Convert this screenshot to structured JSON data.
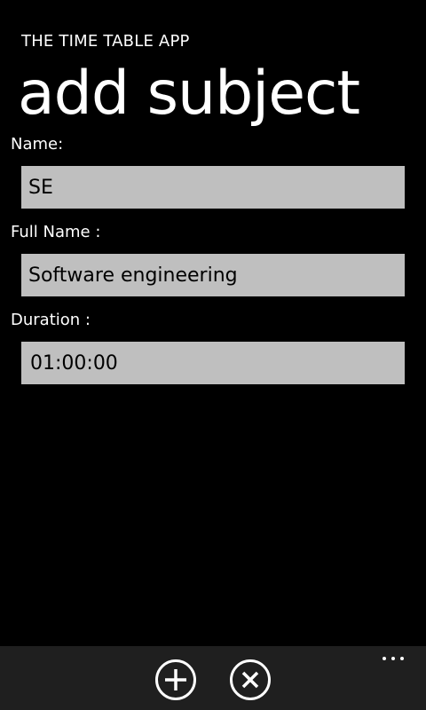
{
  "header": {
    "app_title": "THE TIME TABLE APP",
    "page_title": "add subject"
  },
  "form": {
    "name": {
      "label": "Name:",
      "value": "SE"
    },
    "full_name": {
      "label": "Full Name :",
      "value": "Software engineering"
    },
    "duration": {
      "label": "Duration :",
      "value": "01:00:00"
    }
  },
  "app_bar": {
    "buttons": [
      {
        "icon": "add-icon"
      },
      {
        "icon": "cancel-icon"
      }
    ],
    "more_icon": "ellipsis-icon"
  },
  "colors": {
    "background": "#000000",
    "text": "#ffffff",
    "input_background": "#bfbfbf",
    "app_bar_background": "#1f1f1f"
  }
}
